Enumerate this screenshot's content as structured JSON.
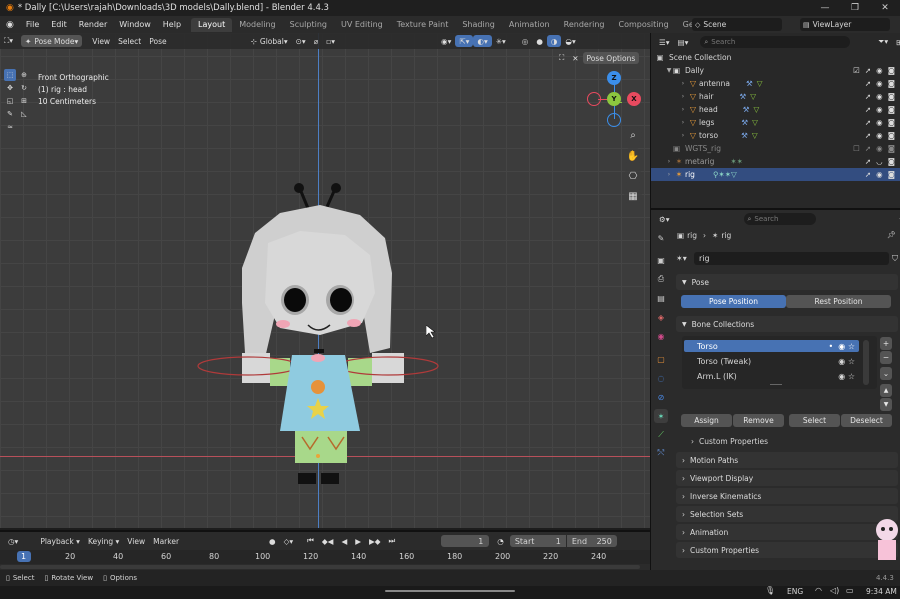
{
  "window": {
    "title": "* Dally [C:\\Users\\rajah\\Downloads\\3D models\\Dally.blend] - Blender 4.4.3"
  },
  "menubar": {
    "menus": [
      "File",
      "Edit",
      "Render",
      "Window",
      "Help"
    ],
    "workspaces": [
      "Layout",
      "Modeling",
      "Sculpting",
      "UV Editing",
      "Texture Paint",
      "Shading",
      "Animation",
      "Rendering",
      "Compositing",
      "Geometry Nodes",
      "Sc"
    ],
    "active_workspace": "Layout",
    "scene": "Scene",
    "view_layer": "ViewLayer"
  },
  "viewport": {
    "mode": "Pose Mode",
    "menus": [
      "View",
      "Select",
      "Pose"
    ],
    "orientation": "Global",
    "overlay_info": {
      "view": "Front Orthographic",
      "context": "(1) rig : head",
      "scale": "10 Centimeters"
    },
    "pose_options": "Pose Options",
    "gizmo": {
      "x": "X",
      "y": "Y",
      "z": "Z"
    }
  },
  "outliner": {
    "search_placeholder": "Search",
    "root": "Scene Collection",
    "items": [
      {
        "label": "Dally",
        "type": "collection"
      },
      {
        "label": "antenna",
        "type": "mesh"
      },
      {
        "label": "hair",
        "type": "mesh"
      },
      {
        "label": "head",
        "type": "mesh"
      },
      {
        "label": "legs",
        "type": "mesh"
      },
      {
        "label": "torso",
        "type": "mesh"
      },
      {
        "label": "WGTS_rig",
        "type": "collection"
      },
      {
        "label": "metarig",
        "type": "armature"
      },
      {
        "label": "rig",
        "type": "armature"
      }
    ]
  },
  "properties": {
    "search_placeholder": "Search",
    "breadcrumb": [
      "rig",
      "rig"
    ],
    "object_name": "rig",
    "pose_header": "Pose",
    "pose_position": "Pose Position",
    "rest_position": "Rest Position",
    "bone_collections_header": "Bone Collections",
    "bone_collections": [
      "Torso",
      "Torso (Tweak)",
      "Arm.L (IK)"
    ],
    "buttons": {
      "assign": "Assign",
      "remove": "Remove",
      "select": "Select",
      "deselect": "Deselect"
    },
    "custom_properties_inner": "Custom Properties",
    "sections": [
      "Motion Paths",
      "Viewport Display",
      "Inverse Kinematics",
      "Selection Sets",
      "Animation",
      "Custom Properties"
    ]
  },
  "timeline": {
    "menus": [
      "Playback",
      "Keying",
      "View",
      "Marker"
    ],
    "current_frame": "1",
    "start_label": "Start",
    "start": "1",
    "end_label": "End",
    "end": "250",
    "ruler": [
      "1",
      "20",
      "40",
      "60",
      "80",
      "100",
      "120",
      "140",
      "160",
      "180",
      "200",
      "220",
      "240"
    ]
  },
  "statusbar": {
    "hints": [
      "Select",
      "Rotate View",
      "Options"
    ],
    "version": "4.4.3"
  },
  "taskbar": {
    "lang": "ENG",
    "time": "9:34 AM"
  },
  "colors": {
    "accent": "#4772b3",
    "selection": "#334d80",
    "axis_x": "#e84a5f",
    "axis_y": "#8cc63f",
    "axis_z": "#3b8eea"
  }
}
